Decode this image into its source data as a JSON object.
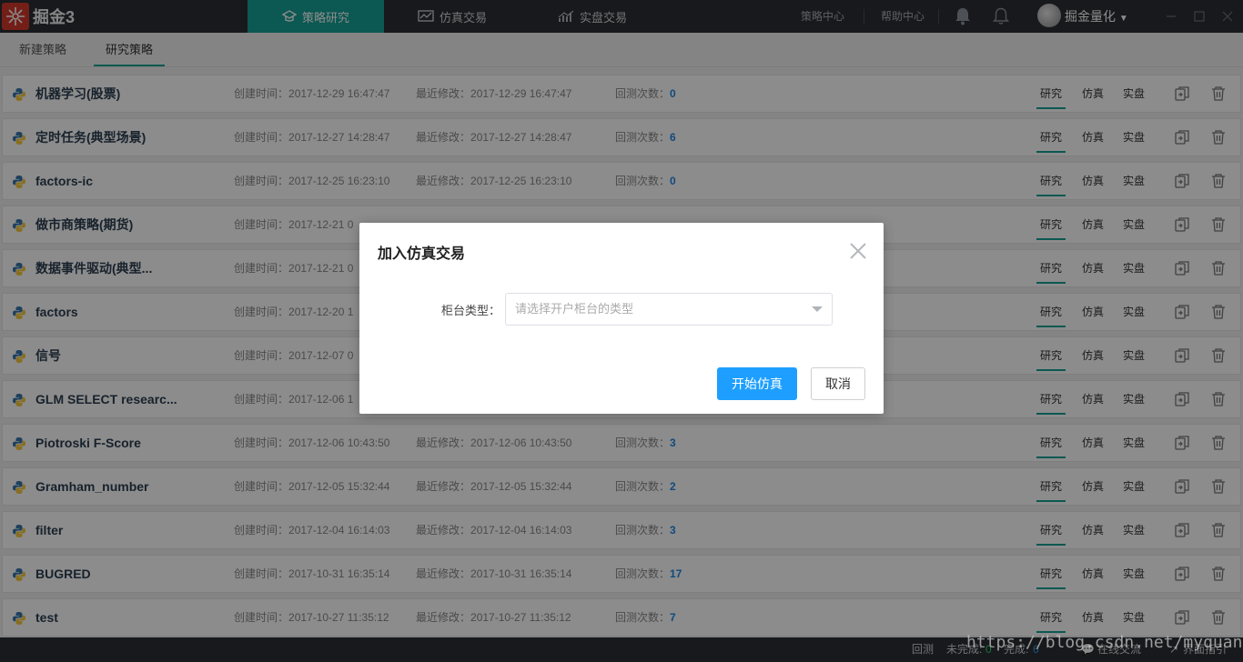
{
  "app": {
    "name": "掘金3"
  },
  "nav": {
    "tabs": [
      {
        "label": "策略研究",
        "active": true
      },
      {
        "label": "仿真交易",
        "active": false
      },
      {
        "label": "实盘交易",
        "active": false
      }
    ],
    "links": [
      "策略中心",
      "帮助中心"
    ],
    "user": "掘金量化",
    "accent": "#17a095"
  },
  "subtabs": [
    {
      "label": "新建策略",
      "active": false
    },
    {
      "label": "研究策略",
      "active": true
    }
  ],
  "labels": {
    "created": "创建时间：",
    "modified": "最近修改：",
    "backtests": "回测次数："
  },
  "row_actions": [
    "研究",
    "仿真",
    "实盘"
  ],
  "strategies": [
    {
      "name": "机器学习(股票)",
      "created": "2017-12-29 16:47:47",
      "modified": "2017-12-29 16:47:47",
      "backtests": "0"
    },
    {
      "name": "定时任务(典型场景)",
      "created": "2017-12-27 14:28:47",
      "modified": "2017-12-27 14:28:47",
      "backtests": "6"
    },
    {
      "name": "factors-ic",
      "created": "2017-12-25 16:23:10",
      "modified": "2017-12-25 16:23:10",
      "backtests": "0"
    },
    {
      "name": "做市商策略(期货)",
      "created": "2017-12-21 0",
      "modified": "",
      "backtests": ""
    },
    {
      "name": "数据事件驱动(典型...",
      "created": "2017-12-21 0",
      "modified": "",
      "backtests": ""
    },
    {
      "name": "factors",
      "created": "2017-12-20 1",
      "modified": "",
      "backtests": ""
    },
    {
      "name": "信号",
      "created": "2017-12-07 0",
      "modified": "",
      "backtests": ""
    },
    {
      "name": "GLM SELECT researc...",
      "created": "2017-12-06 1",
      "modified": "",
      "backtests": ""
    },
    {
      "name": "Piotroski F-Score",
      "created": "2017-12-06 10:43:50",
      "modified": "2017-12-06 10:43:50",
      "backtests": "3"
    },
    {
      "name": "Gramham_number",
      "created": "2017-12-05 15:32:44",
      "modified": "2017-12-05 15:32:44",
      "backtests": "2"
    },
    {
      "name": "filter",
      "created": "2017-12-04 16:14:03",
      "modified": "2017-12-04 16:14:03",
      "backtests": "3"
    },
    {
      "name": "BUGRED",
      "created": "2017-10-31 16:35:14",
      "modified": "2017-10-31 16:35:14",
      "backtests": "17"
    },
    {
      "name": "test",
      "created": "2017-10-27 11:35:12",
      "modified": "2017-10-27 11:35:12",
      "backtests": "7"
    }
  ],
  "bottom": {
    "backtest": "回测",
    "unfinished_label": "未完成:",
    "unfinished": "0",
    "done_label": "完成:",
    "done": "6",
    "chat": "在线交流",
    "guide": "界面指引"
  },
  "watermark": "https://blog.csdn.net/myquant",
  "modal": {
    "title": "加入仿真交易",
    "field_label": "柜台类型：",
    "placeholder": "请选择开户柜台的类型",
    "confirm": "开始仿真",
    "cancel": "取消"
  }
}
